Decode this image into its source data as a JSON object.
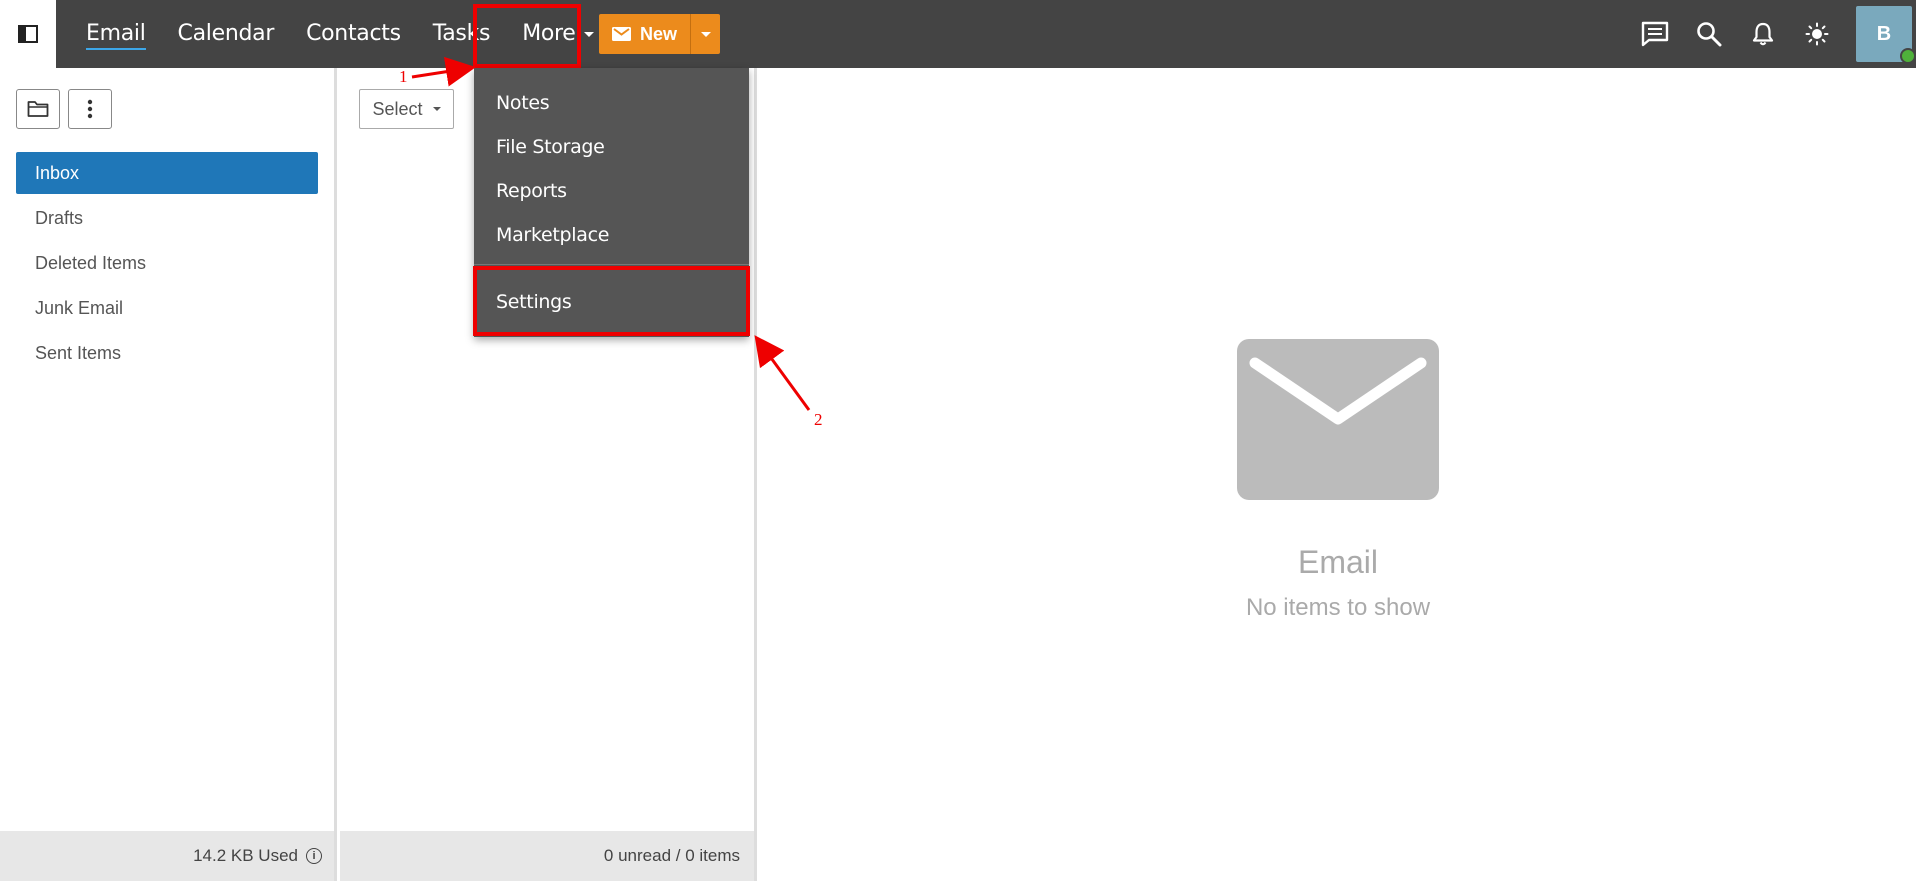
{
  "nav": {
    "items": [
      "Email",
      "Calendar",
      "Contacts",
      "Tasks"
    ],
    "more_label": "More",
    "new_label": "New"
  },
  "user": {
    "avatar_letter": "B"
  },
  "dropdown": {
    "items": [
      "Notes",
      "File Storage",
      "Reports",
      "Marketplace"
    ],
    "settings_label": "Settings"
  },
  "folders": [
    "Inbox",
    "Drafts",
    "Deleted Items",
    "Junk Email",
    "Sent Items"
  ],
  "left_footer": {
    "storage_used": "14.2 KB Used"
  },
  "middle": {
    "select_label": "Select",
    "status": "0 unread / 0 items"
  },
  "empty_state": {
    "title": "Email",
    "subtitle": "No items to show"
  },
  "annotations": {
    "step1": "1",
    "step2": "2"
  },
  "colors": {
    "topbar": "#444444",
    "accent_orange": "#ec8b1c",
    "active_folder": "#1f77b8",
    "highlight": "#ee0000"
  }
}
